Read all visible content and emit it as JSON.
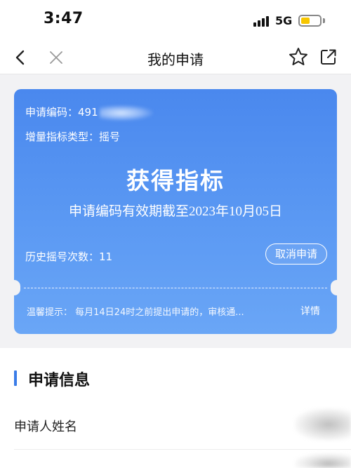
{
  "status_bar": {
    "time": "3:47",
    "network": "5G",
    "battery_level": 0.4,
    "battery_color": "#f7c600"
  },
  "nav": {
    "back_icon": "chevron-left-icon",
    "close_icon": "close-icon",
    "title": "我的申请",
    "star_icon": "star-icon",
    "share_icon": "share-icon"
  },
  "card": {
    "code_label": "申请编码：",
    "code_value": "491",
    "type_label": "增量指标类型：",
    "type_value": "摇号",
    "headline": "获得指标",
    "validity": "申请编码有效期截至2023年10月05日",
    "history_label": "历史摇号次数：",
    "history_value": "11",
    "cancel_button": "取消申请",
    "tip": "温馨提示：  每月14日24时之前提出申请的，审核通...",
    "details_link": "详情",
    "gradient_top": "#4a88ee",
    "gradient_bottom": "#6aa6f6"
  },
  "section": {
    "title": "申请信息",
    "accent": "#3a7ce8",
    "fields": [
      {
        "label": "申请人姓名"
      }
    ]
  }
}
